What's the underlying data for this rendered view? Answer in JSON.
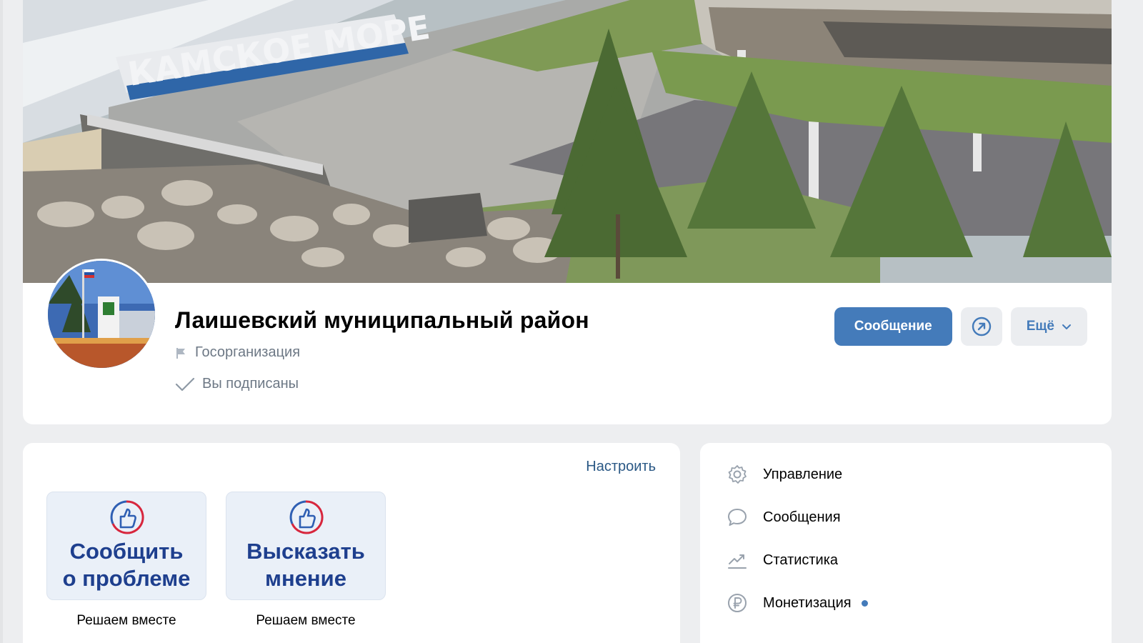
{
  "cover": {
    "sign_text": "КАМСКОЕ МОРЕ"
  },
  "group": {
    "name": "Лаишевский муниципальный район",
    "type": "Госорганизация",
    "subscription_status": "Вы подписаны"
  },
  "actions": {
    "message_label": "Сообщение",
    "more_label": "Ещё"
  },
  "widgets": {
    "configure_label": "Настроить",
    "items": [
      {
        "title_line1": "Сообщить",
        "title_line2": "о проблеме",
        "caption": "Решаем вместе"
      },
      {
        "title_line1": "Высказать",
        "title_line2": "мнение",
        "caption": "Решаем вместе"
      }
    ]
  },
  "menu": {
    "items": [
      {
        "label": "Управление",
        "icon": "gear-icon"
      },
      {
        "label": "Сообщения",
        "icon": "chat-bubble-icon"
      },
      {
        "label": "Статистика",
        "icon": "trend-up-icon"
      },
      {
        "label": "Монетизация",
        "icon": "ruble-coin-icon",
        "badge": "new-dot"
      }
    ]
  },
  "colors": {
    "accent": "#447bba",
    "link": "#2a5885",
    "page_bg": "#edeef0",
    "widget_bg": "#eaf0f8",
    "widget_title": "#1e3f8e"
  }
}
